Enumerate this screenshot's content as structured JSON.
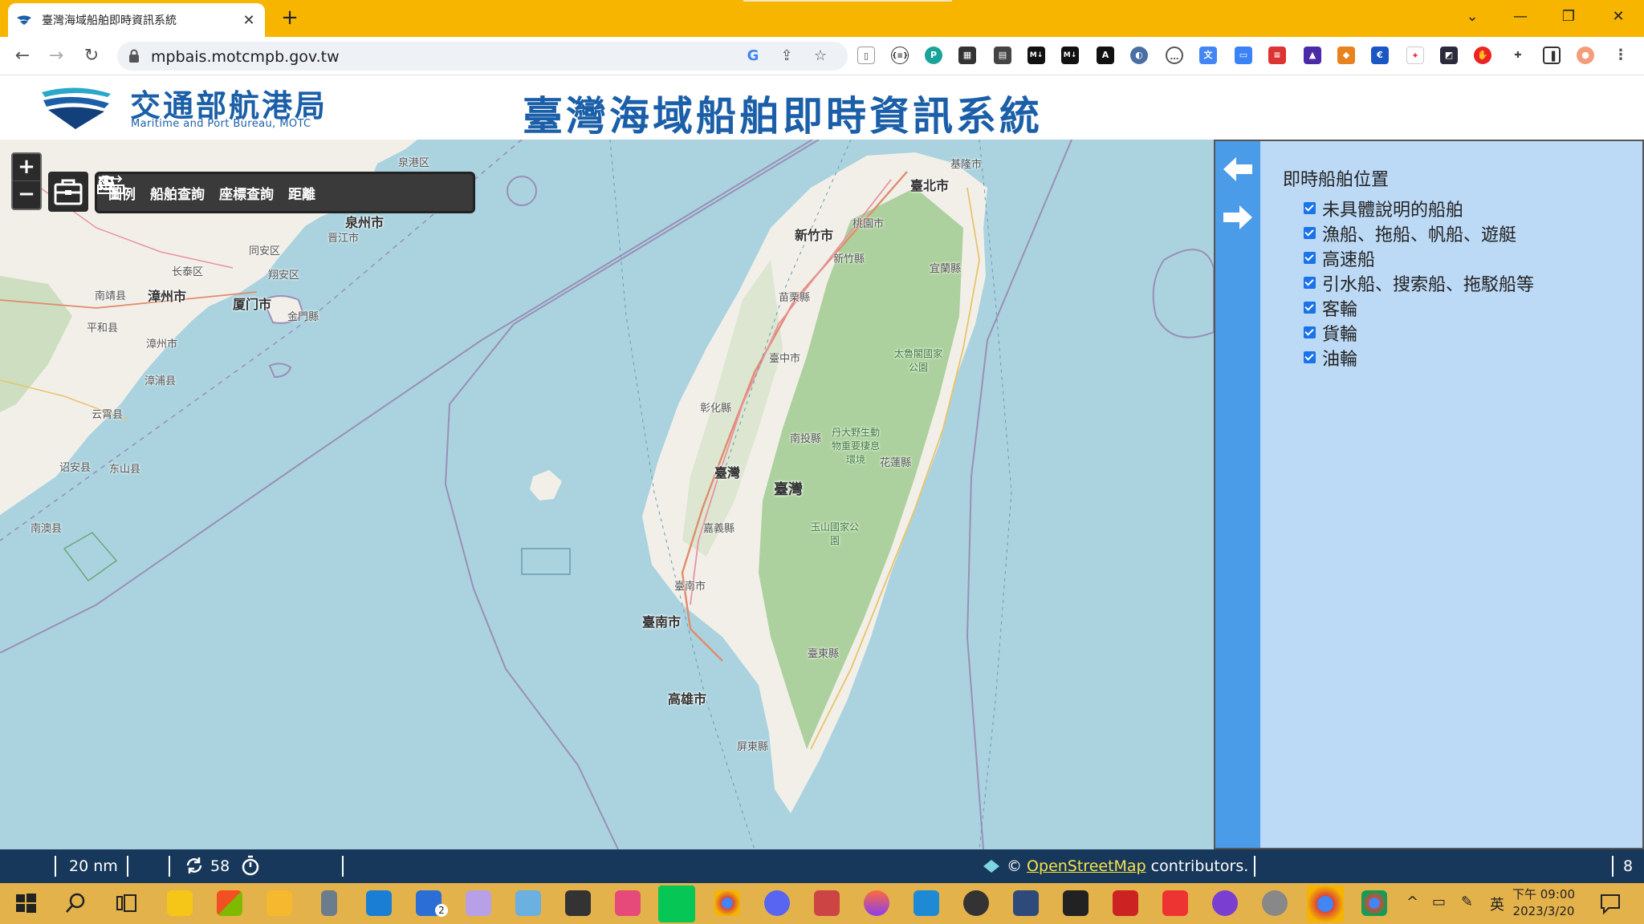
{
  "browser": {
    "tab_title": "臺灣海域船舶即時資訊系統",
    "tab_close": "✕",
    "new_tab": "+",
    "url": "mpbais.motcmpb.gov.tw",
    "window_controls": {
      "tab_search": "⌄",
      "minimize": "—",
      "maximize": "❐",
      "close": "✕"
    },
    "nav": {
      "back": "←",
      "forward": "→",
      "reload": "↻"
    }
  },
  "header": {
    "org_name_zh": "交通部航港局",
    "org_name_en": "Maritime and Port Bureau, MOTC",
    "system_title": "臺灣海域船舶即時資訊系統"
  },
  "map": {
    "zoom_in": "+",
    "zoom_out": "−",
    "tools": [
      {
        "label": "圖例",
        "icon": "list-icon"
      },
      {
        "label": "船舶查詢",
        "icon": "zoom-search-icon"
      },
      {
        "label": "座標查詢",
        "icon": "location-search-icon"
      },
      {
        "label": "距離",
        "icon": "ruler-icon"
      }
    ],
    "labels": {
      "quanzhou_port": "泉港区",
      "quanzhou": "泉州市",
      "jinjiang": "晋江市",
      "tongan": "同安区",
      "changtai": "长泰区",
      "xiangan": "翔安区",
      "nanjing": "南靖县",
      "zhangzhou": "漳州市",
      "xiamen": "厦门市",
      "kinmen": "金門縣",
      "pinghe": "平和县",
      "zhangzhou2": "漳州市",
      "zhangpu": "漳浦县",
      "yunxiao": "云霄县",
      "zhaoan": "诏安县",
      "dongshan": "东山县",
      "nanao": "南澳县",
      "keelung": "基隆市",
      "taipei": "臺北市",
      "hsinchu_city": "新竹市",
      "taoyuan": "桃園市",
      "hsinchu": "新竹縣",
      "yilan": "宜蘭縣",
      "miaoli": "苗栗縣",
      "taichung": "臺中市",
      "taroko": "太魯閣國家公園",
      "changhua": "彰化縣",
      "nantou": "南投縣",
      "danda": "丹大野生動物重要棲息環境",
      "hualien": "花蓮縣",
      "taiwan_county": "臺灣",
      "taiwan": "臺灣",
      "chiayi": "嘉義縣",
      "yushan": "玉山國家公園",
      "tainan_city": "臺南市",
      "tainan": "臺南市",
      "taitung": "臺東縣",
      "kaohsiung": "高雄市",
      "pingtung": "屏東縣"
    }
  },
  "panel": {
    "nav_left": "collapse-left-arrow",
    "nav_right": "expand-right-arrow",
    "legend_title": "即時船舶位置",
    "legend_items": [
      "未具體說明的船舶",
      "漁船、拖船、帆船、遊艇",
      "高速船",
      "引水船、搜索船、拖駁船等",
      "客輪",
      "貨輪",
      "油輪"
    ]
  },
  "status": {
    "scale": "20 nm",
    "refresh_count": "58",
    "attribution_prefix": "©",
    "attribution_link": "OpenStreetMap",
    "attribution_suffix": "contributors.",
    "right_value": "8"
  },
  "taskbar": {
    "time": "下午 09:00",
    "date": "2023/3/20",
    "ime": "英",
    "badge_2": "2"
  },
  "colors": {
    "tabstrip": "#f7b500",
    "header_blue": "#1b5fa8",
    "sea": "#aad3df",
    "land": "#f2efe9",
    "forest": "#add19e",
    "panel_bg": "#bcd9f5",
    "panel_nav": "#4a9ce8",
    "statusbar": "#17385a",
    "taskbar": "#e4b24a"
  }
}
